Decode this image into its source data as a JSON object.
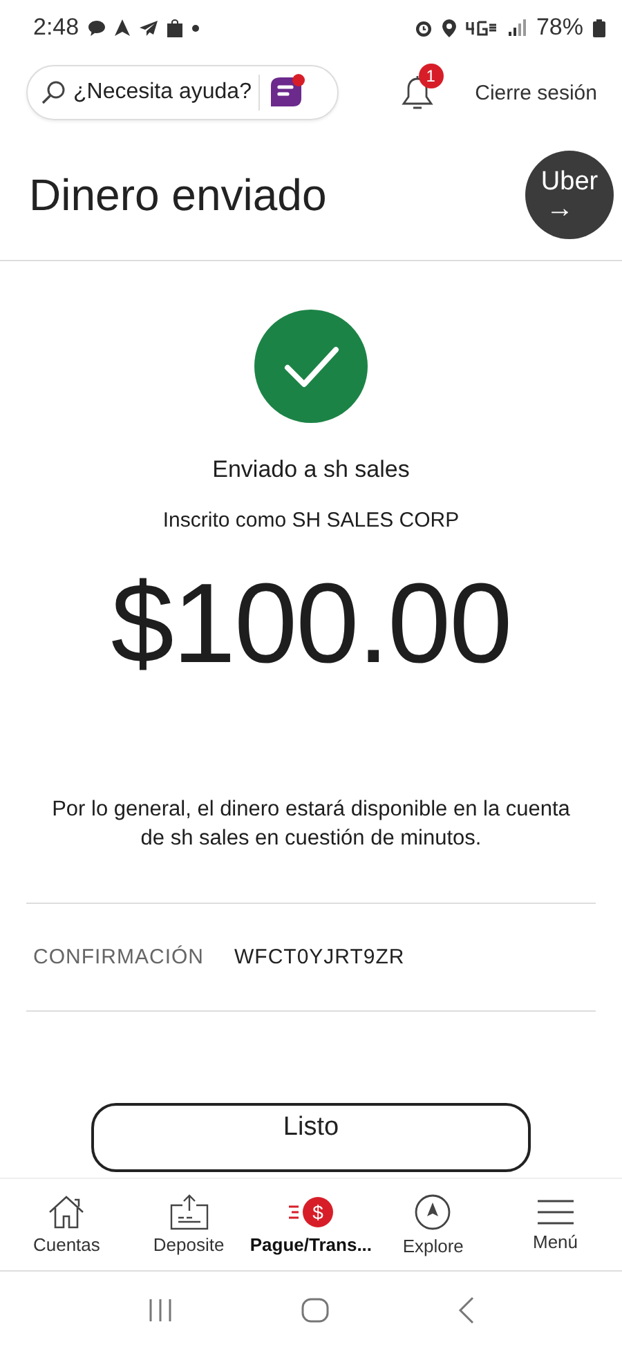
{
  "status_bar": {
    "time": "2:48",
    "battery": "78%"
  },
  "header": {
    "search": {
      "placeholder": "¿Necesita ayuda?"
    },
    "notifications": {
      "badge": "1"
    },
    "logout": "Cierre sesión"
  },
  "title": "Dinero enviado",
  "promo": {
    "label": "Uber",
    "arrow": "→"
  },
  "confirmation": {
    "sent_to": "Enviado a sh sales",
    "enrolled_as": "Inscrito como SH SALES CORP",
    "amount": "$100.00",
    "note": "Por lo general, el dinero estará disponible en la cuenta de sh sales en cuestión de minutos.",
    "label": "CONFIRMACIÓN",
    "code": "WFCT0YJRT9ZR"
  },
  "done_button": "Listo",
  "bottom_nav": [
    {
      "label": "Cuentas",
      "selected": false
    },
    {
      "label": "Deposite",
      "selected": false
    },
    {
      "label": "Pague/Trans...",
      "selected": true,
      "symbol": "$"
    },
    {
      "label": "Explore",
      "selected": false
    },
    {
      "label": "Menú",
      "selected": false
    }
  ]
}
